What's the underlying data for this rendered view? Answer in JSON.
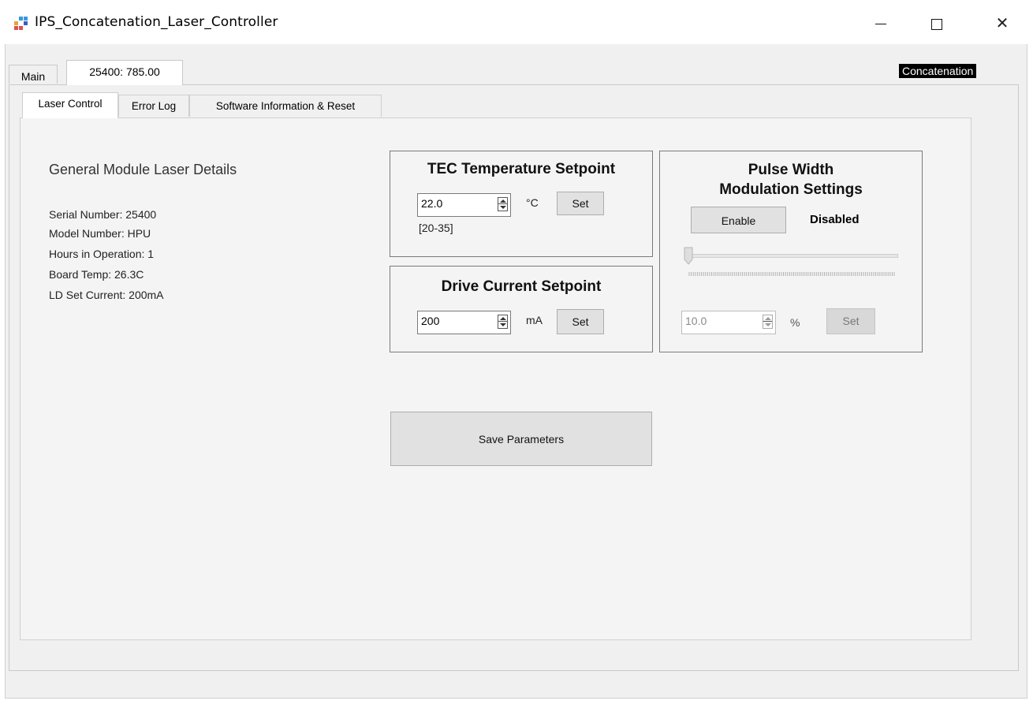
{
  "window": {
    "title": "IPS_Concatenation_Laser_Controller",
    "icon": "app-icon",
    "controls": {
      "minimize": "minimize-icon",
      "maximize": "maximize-icon",
      "close": "✕"
    }
  },
  "outer_tabs": [
    {
      "label": "Main",
      "selected": false
    },
    {
      "label": "25400: 785.00",
      "selected": true
    }
  ],
  "mode_badge": "Concatenation",
  "inner_tabs": [
    {
      "label": "Laser Control",
      "selected": true
    },
    {
      "label": "Error Log",
      "selected": false
    },
    {
      "label": "Software Information & Reset",
      "selected": false
    }
  ],
  "details": {
    "heading": "General Module Laser Details",
    "serial": "Serial Number:  25400",
    "model": "Model Number:  HPU",
    "hours": "Hours in Operation: 1",
    "board_temp": "Board Temp: 26.3C",
    "ld_current": "LD Set Current: 200mA"
  },
  "tec": {
    "title": "TEC Temperature Setpoint",
    "value": "22.0",
    "unit": "°C",
    "set_label": "Set",
    "range": "[20-35]"
  },
  "drive": {
    "title": "Drive Current Setpoint",
    "value": "200",
    "unit": "mA",
    "set_label": "Set"
  },
  "pwm": {
    "title_line1": "Pulse Width",
    "title_line2": "Modulation Settings",
    "enable_label": "Enable",
    "status": "Disabled",
    "slider_fraction": 0.0,
    "value": "10.0",
    "unit": "%",
    "set_label": "Set",
    "enabled": false
  },
  "save_label": "Save Parameters"
}
